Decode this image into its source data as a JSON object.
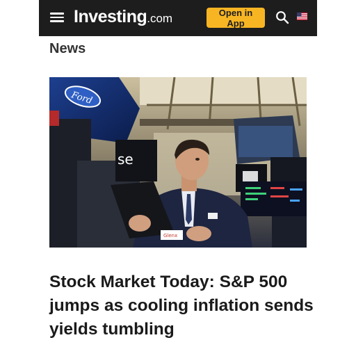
{
  "header": {
    "logo_main": "Investing",
    "logo_tld": ".com",
    "open_app_label": "Open in App",
    "menu_icon": "hamburger-menu-icon",
    "search_icon": "search-icon",
    "flag_icon": "us-flag-icon"
  },
  "colors": {
    "header_bg": "#1d1d1d",
    "cta": "#f8b523"
  },
  "section": {
    "title": "News"
  },
  "article": {
    "headline": "Stock Market Today: S&P 500 jumps as cooling inflation sends yields tumbling",
    "image_alt": "Trader on the stock exchange floor"
  }
}
